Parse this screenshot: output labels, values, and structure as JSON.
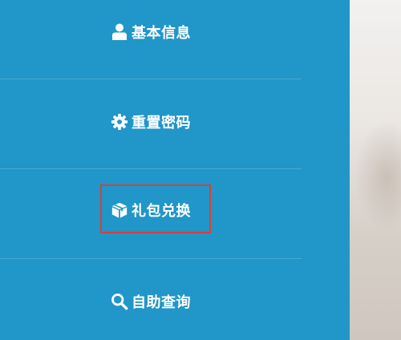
{
  "menu": {
    "items": [
      {
        "label": "基本信息",
        "icon": "user-icon"
      },
      {
        "label": "重置密码",
        "icon": "gear-icon"
      },
      {
        "label": "礼包兑换",
        "icon": "gift-box-icon",
        "highlighted": true
      },
      {
        "label": "自助查询",
        "icon": "search-icon"
      }
    ]
  },
  "colors": {
    "menu_background": "#2196c8",
    "text": "#ffffff",
    "highlight_border": "#d6403a"
  }
}
